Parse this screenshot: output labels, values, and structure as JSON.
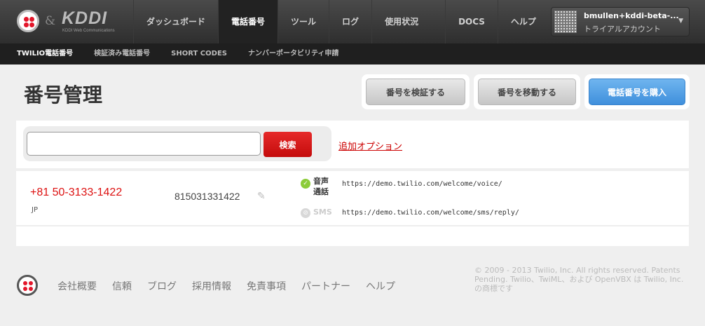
{
  "brand": {
    "ampersand": "&",
    "kddi": "KDDI",
    "kddi_sub": "KDDI Web Communications"
  },
  "nav": {
    "items": [
      {
        "label": "ダッシュボード"
      },
      {
        "label": "電話番号",
        "active": true
      },
      {
        "label": "ツール"
      },
      {
        "label": "ログ"
      },
      {
        "label": "使用状況"
      },
      {
        "label": "DOCS"
      },
      {
        "label": "ヘルプ"
      }
    ]
  },
  "account": {
    "name": "bmullen+kddi-beta-...",
    "type": "トライアルアカウント"
  },
  "subnav": {
    "items": [
      {
        "label": "TWILIO電話番号"
      },
      {
        "label": "検証済み電話番号"
      },
      {
        "label": "SHORT CODES"
      },
      {
        "label": "ナンバーポータビリティ申請"
      }
    ]
  },
  "page": {
    "title": "番号管理",
    "verify_button": "番号を検証する",
    "move_button": "番号を移動する",
    "buy_button": "電話番号を購入"
  },
  "search": {
    "value": "",
    "button": "検索",
    "more_options": "追加オプション"
  },
  "numbers": [
    {
      "phone": "+81 50-3133-1422",
      "country": "JP",
      "friendly_name": "815031331422",
      "voice_label": "音声通話",
      "voice_enabled": true,
      "voice_url": "https://demo.twilio.com/welcome/voice/",
      "sms_label": "SMS",
      "sms_enabled": false,
      "sms_url": "https://demo.twilio.com/welcome/sms/reply/"
    }
  ],
  "footer": {
    "links": [
      "会社概要",
      "信頼",
      "ブログ",
      "採用情報",
      "免責事項",
      "パートナー",
      "ヘルプ"
    ],
    "copyright": "© 2009 - 2013 Twilio, Inc. All rights reserved. Patents Pending. Twilio、TwiML、および OpenVBX は Twilio, Inc. の商標です"
  },
  "colors": {
    "accent_red": "#d11111",
    "buy_blue": "#3f8fdc",
    "check_green": "#8ccc3a"
  },
  "icons": {
    "logo": "twilio-logo-icon",
    "dropdown": "chevron-down-icon",
    "edit": "pencil-icon",
    "enabled": "check-icon",
    "disabled": "disabled-icon"
  }
}
